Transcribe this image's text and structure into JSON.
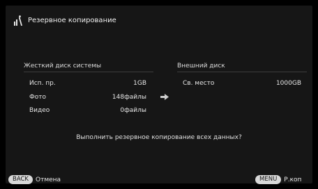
{
  "header": {
    "title": "Резервное копирование",
    "icon": "backup-icon"
  },
  "system_disk": {
    "title": "Жесткий диск системы",
    "rows": [
      {
        "label": "Исп. пр.",
        "value": "1GB"
      },
      {
        "label": "Фото",
        "value": "148файлы"
      },
      {
        "label": "Видео",
        "value": "0файлы"
      }
    ]
  },
  "external_disk": {
    "title": "Внешний диск",
    "rows": [
      {
        "label": "Св. место",
        "value": "1000GB"
      }
    ]
  },
  "transfer_icon": "arrow-right-icon",
  "question": "Выполнить резервное копирование всех данных?",
  "footer": {
    "back": {
      "key": "BACK",
      "label": "Отмена"
    },
    "menu": {
      "key": "MENU",
      "label": "Р.коп"
    }
  },
  "colors": {
    "background": "#161616",
    "text": "#e8e8e8",
    "pill": "#d8d8d8"
  }
}
